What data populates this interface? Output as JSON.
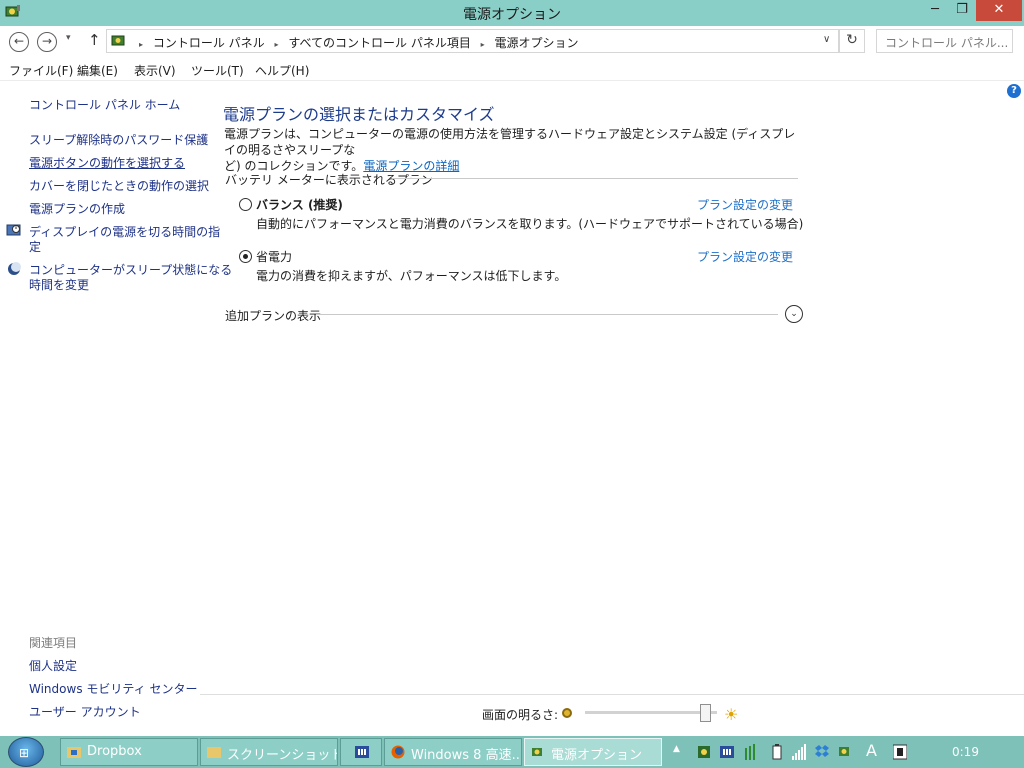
{
  "window": {
    "title": "電源オプション",
    "min_icon": "minimize-icon",
    "max_icon": "maximize-icon",
    "close_icon": "close-icon",
    "min_glyph": "─",
    "max_glyph": "❐",
    "close_glyph": "✕"
  },
  "address": {
    "back_glyph": "←",
    "forward_glyph": "→",
    "recent_glyph": "▾",
    "up_glyph": "↑",
    "breadcrumbs": [
      "コントロール パネル",
      "すべてのコントロール パネル項目",
      "電源オプション"
    ],
    "separator": "▸",
    "dropdown_glyph": "∨",
    "refresh_glyph": "↻",
    "search_placeholder": "コントロール パネル..."
  },
  "menu": [
    "ファイル(F)",
    "編集(E)",
    "表示(V)",
    "ツール(T)",
    "ヘルプ(H)"
  ],
  "help_glyph": "?",
  "sidebar": {
    "home": "コントロール パネル ホーム",
    "links": [
      "スリープ解除時のパスワード保護",
      "電源ボタンの動作を選択する",
      "カバーを閉じたときの動作の選択",
      "電源プランの作成",
      "ディスプレイの電源を切る時間の指",
      "定",
      "コンピューターがスリープ状態になる",
      "時間を変更"
    ],
    "related_title": "関連項目",
    "related_links": [
      "個人設定",
      "Windows モビリティ センター",
      "ユーザー アカウント"
    ]
  },
  "main": {
    "title": "電源プランの選択またはカスタマイズ",
    "desc_line1": "電源プランは、コンピューターの電源の使用方法を管理するハードウェア設定とシステム設定 (ディスプレイの明るさやスリープな",
    "desc_line2": "ど) のコレクションです。",
    "desc_link": "電源プランの詳細",
    "section_label": "バッテリ メーターに表示されるプラン",
    "plans": [
      {
        "name": "バランス (推奨)",
        "description": "自動的にパフォーマンスと電力消費のバランスを取ります。(ハードウェアでサポートされている場合)",
        "change_link": "プラン設定の変更",
        "selected": false
      },
      {
        "name": "省電力",
        "description": "電力の消費を抑えますが、パフォーマンスは低下します。",
        "change_link": "プラン設定の変更",
        "selected": true
      }
    ],
    "more_plans": "追加プランの表示",
    "more_glyph": "⌄"
  },
  "brightness": {
    "label": "画面の明るさ:",
    "level_percent": 95,
    "bright_glyph": "☀"
  },
  "taskbar": {
    "start_glyph": "⊞",
    "buttons": [
      "Dropbox",
      "スクリーンショット",
      "",
      "Windows 8 高速...",
      "電源オプション"
    ],
    "tray_lang": "A",
    "tray_chevron": "▲",
    "clock": "0:19"
  },
  "colors": {
    "titlebar": "#89cfc7",
    "taskbar": "#7ec1b9",
    "link": "#1e3287",
    "heading": "#1e3c8c",
    "close_button": "#c74a3a"
  }
}
